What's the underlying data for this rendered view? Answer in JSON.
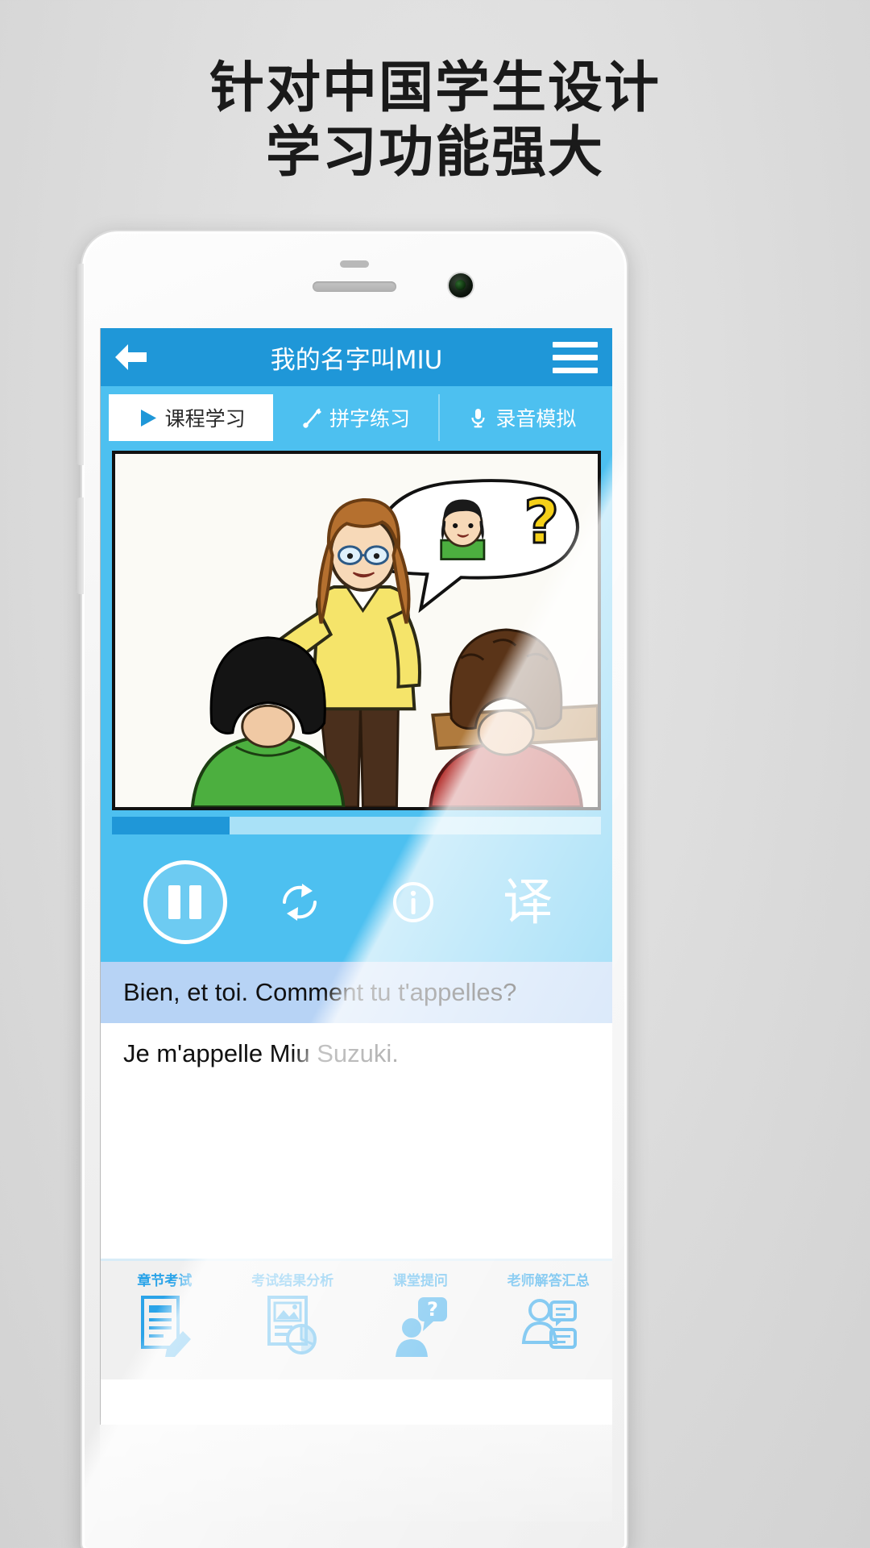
{
  "headline": {
    "line1": "针对中国学生设计",
    "line2": "学习功能强大"
  },
  "app": {
    "title": "我的名字叫MIU",
    "back_icon": "back-arrow-icon",
    "menu_icon": "hamburger-menu-icon",
    "accent_color": "#1f97d8",
    "tab_bg_color": "#4dc0f0"
  },
  "tabs": [
    {
      "label": "课程学习",
      "icon": "play-triangle-icon",
      "active": true
    },
    {
      "label": "拼字练习",
      "icon": "pencil-line-icon",
      "active": false
    },
    {
      "label": "录音模拟",
      "icon": "microphone-icon",
      "active": false
    }
  ],
  "player": {
    "progress_percent": 24,
    "progress_fill_color": "#1f97d8",
    "progress_track_color": "#a9e1f7",
    "pause_label": "pause-icon",
    "loop_label": "loop-repeat-icon",
    "info_label": "info-icon",
    "translate_label": "译"
  },
  "subtitles": [
    {
      "text": "Bien, et toi. Comment tu t'appelles?",
      "highlighted": true
    },
    {
      "text": "Je m'appelle Miu Suzuki.",
      "highlighted": false
    }
  ],
  "bottom_toolbar": [
    {
      "label": "章节考试",
      "icon": "document-pencil-icon"
    },
    {
      "label": "考试结果分析",
      "icon": "report-chart-icon"
    },
    {
      "label": "课堂提问",
      "icon": "person-question-icon"
    },
    {
      "label": "老师解答汇总",
      "icon": "teacher-answer-icon"
    }
  ]
}
